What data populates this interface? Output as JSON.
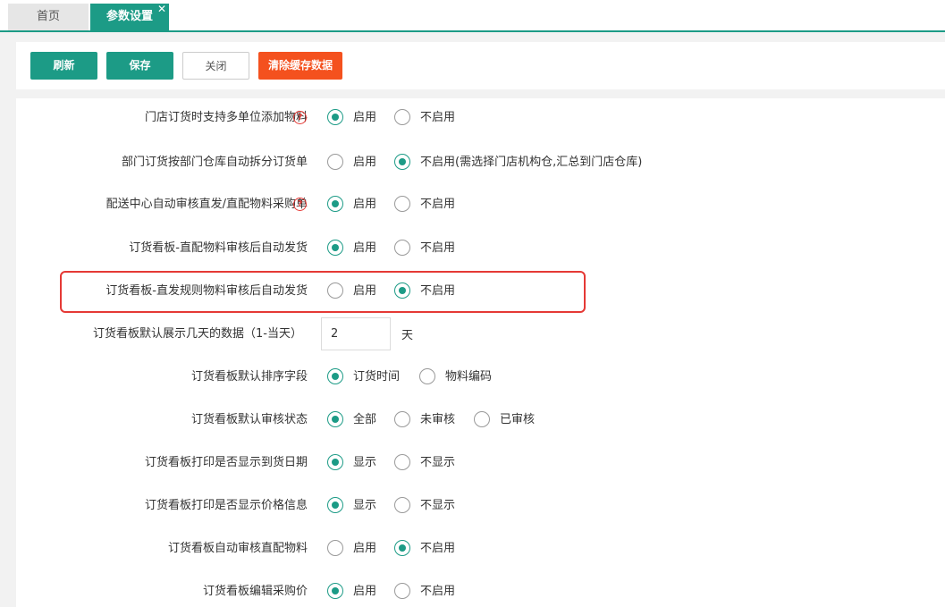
{
  "tabs": [
    {
      "label": "首页",
      "active": false
    },
    {
      "label": "参数设置",
      "active": true,
      "close": "✕"
    }
  ],
  "toolbar": {
    "refresh": "刷新",
    "save": "保存",
    "close": "关闭",
    "clear_cache": "清除缓存数据"
  },
  "colors": {
    "accent": "#1c9b86",
    "danger": "#f4511e",
    "highlight": "#e53935"
  },
  "settings": [
    {
      "label": "门店订货时支持多单位添加物料",
      "help": true,
      "options": [
        "启用",
        "不启用"
      ],
      "selected": 0
    },
    {
      "label": "部门订货按部门仓库自动拆分订货单",
      "help": false,
      "options": [
        "启用",
        "不启用(需选择门店机构仓,汇总到门店仓库)"
      ],
      "selected": 1
    },
    {
      "label": "配送中心自动审核直发/直配物料采购单",
      "help": true,
      "options": [
        "启用",
        "不启用"
      ],
      "selected": 0
    },
    {
      "label": "订货看板-直配物料审核后自动发货",
      "help": false,
      "options": [
        "启用",
        "不启用"
      ],
      "selected": 0
    },
    {
      "label": "订货看板-直发规则物料审核后自动发货",
      "help": false,
      "options": [
        "启用",
        "不启用"
      ],
      "selected": 1,
      "highlighted": true
    },
    {
      "label": "订货看板默认展示几天的数据（1-当天）",
      "input_value": "2",
      "unit": "天"
    },
    {
      "label": "订货看板默认排序字段",
      "help": false,
      "options": [
        "订货时间",
        "物料编码"
      ],
      "selected": 0
    },
    {
      "label": "订货看板默认审核状态",
      "help": false,
      "options": [
        "全部",
        "未审核",
        "已审核"
      ],
      "selected": 0
    },
    {
      "label": "订货看板打印是否显示到货日期",
      "help": false,
      "options": [
        "显示",
        "不显示"
      ],
      "selected": 0
    },
    {
      "label": "订货看板打印是否显示价格信息",
      "help": false,
      "options": [
        "显示",
        "不显示"
      ],
      "selected": 0
    },
    {
      "label": "订货看板自动审核直配物料",
      "help": false,
      "options": [
        "启用",
        "不启用"
      ],
      "selected": 1
    },
    {
      "label": "订货看板编辑采购价",
      "help": false,
      "options": [
        "启用",
        "不启用"
      ],
      "selected": 0
    }
  ]
}
